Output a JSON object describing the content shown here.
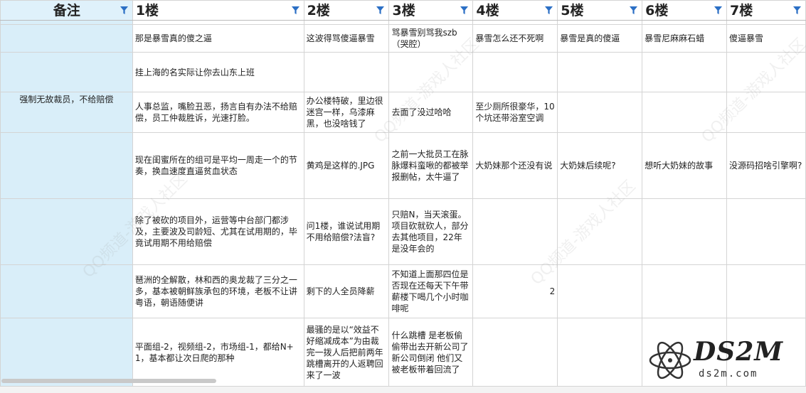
{
  "headers": [
    "备注",
    "1楼",
    "2楼",
    "3楼",
    "4楼",
    "5楼",
    "6楼",
    "7楼"
  ],
  "rows": [
    [
      "",
      "那是暴雪真的傻之逼",
      "这波得骂傻逼暴雪",
      "骂暴雪别骂我szb（哭腔）",
      "暴雪怎么还不死啊",
      "暴雪是真的傻逼",
      "暴雪尼麻麻石蜡",
      "傻逼暴雪"
    ],
    [
      "",
      "挂上海的名实际让你去山东上班",
      "",
      "",
      "",
      "",
      "",
      ""
    ],
    [
      "强制无故裁员，不给赔偿",
      "人事总监，嘴脸丑恶，扬言自有办法不给赔偿，员工仲裁胜诉，光速打脸。",
      "办公楼特破，里边很迷宫一样，乌漆麻黑，也没啥钱了",
      "去面了没过哈哈",
      "至少厕所很豪华，10个坑还带浴室空调",
      "",
      "",
      ""
    ],
    [
      "",
      "现在闺蜜所在的组可是平均一周走一个的节奏，换血速度直逼贫血状态",
      "黄鸡是这样的.JPG",
      "之前一大批员工在脉脉爆料蛮啾的都被举报删帖，太牛逼了",
      "大奶妹那个还没有说",
      "大奶妹后续呢?",
      "想听大奶妹的故事",
      "没源码招啥引擎啊?"
    ],
    [
      "",
      "除了被砍的项目外，运营等中台部门都涉及，主要波及司龄短、尤其在试用期的，毕竟试用期不用给赔偿",
      "问1楼，谁说试用期不用给赔偿?法盲?",
      "只赔N，当天滚蛋。项目砍就砍人，部分去其他项目，22年是没年会的",
      "",
      "",
      "",
      ""
    ],
    [
      "",
      "琶洲的全解散，林和西的奥龙裁了三分之一多，基本被朝鲜族承包的环境，老板不让讲粤语，朝语随便讲",
      "剩下的人全员降薪",
      "不知道上面那四位是否现在还每天下午带薪楼下喝几个小时咖啡呢",
      "2",
      "",
      "",
      ""
    ],
    [
      "",
      "平面组-2，视频组-2，市场组-1，都给N+1，基本都让次日爬的那种",
      "最骚的是以“效益不好缩减成本”为由裁完一拨人后把前两年跳槽离开的人返聘回来了一波",
      "什么跳槽 是老板偷偷带出去开新公司了 新公司倒闭 他们又被老板带着回流了",
      "",
      "",
      "",
      ""
    ]
  ],
  "watermark": "QQ频道-游戏人社区",
  "logo": {
    "title": "DS2M",
    "subtitle": "ds2m.com"
  }
}
